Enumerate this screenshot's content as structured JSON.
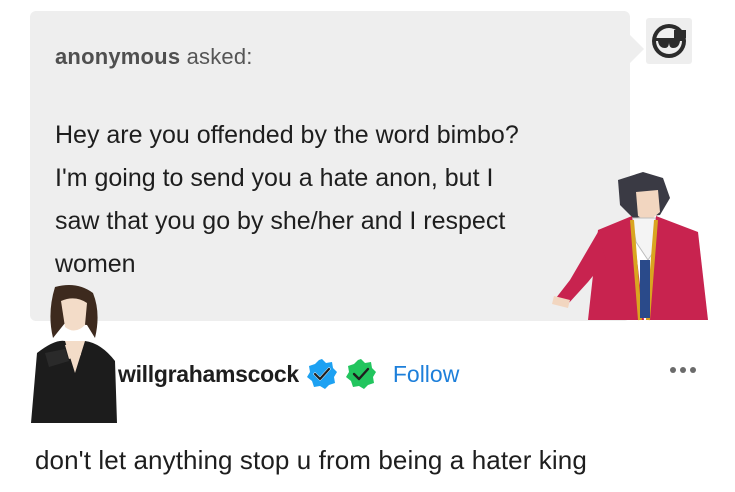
{
  "ask": {
    "asker": "anonymous",
    "verb": "asked:",
    "lines": [
      "Hey are you offended by the word bimbo?",
      "I'm going to send you a hate anon, but I",
      "saw that you go by she/her and I respect",
      "women"
    ]
  },
  "post": {
    "username": "willgrahamscock",
    "follow_label": "Follow",
    "text": "don't let anything stop u from being a hater king"
  },
  "colors": {
    "bubble": "#eeeeee",
    "follow": "#1d7fda",
    "badge_blue": "#1da1f2",
    "badge_green": "#22c55e"
  },
  "icons": {
    "anon_avatar": "anonymous-sunglasses-icon",
    "badge_1": "verified-check-icon",
    "badge_2": "verified-check-icon",
    "more": "more-options-icon"
  }
}
